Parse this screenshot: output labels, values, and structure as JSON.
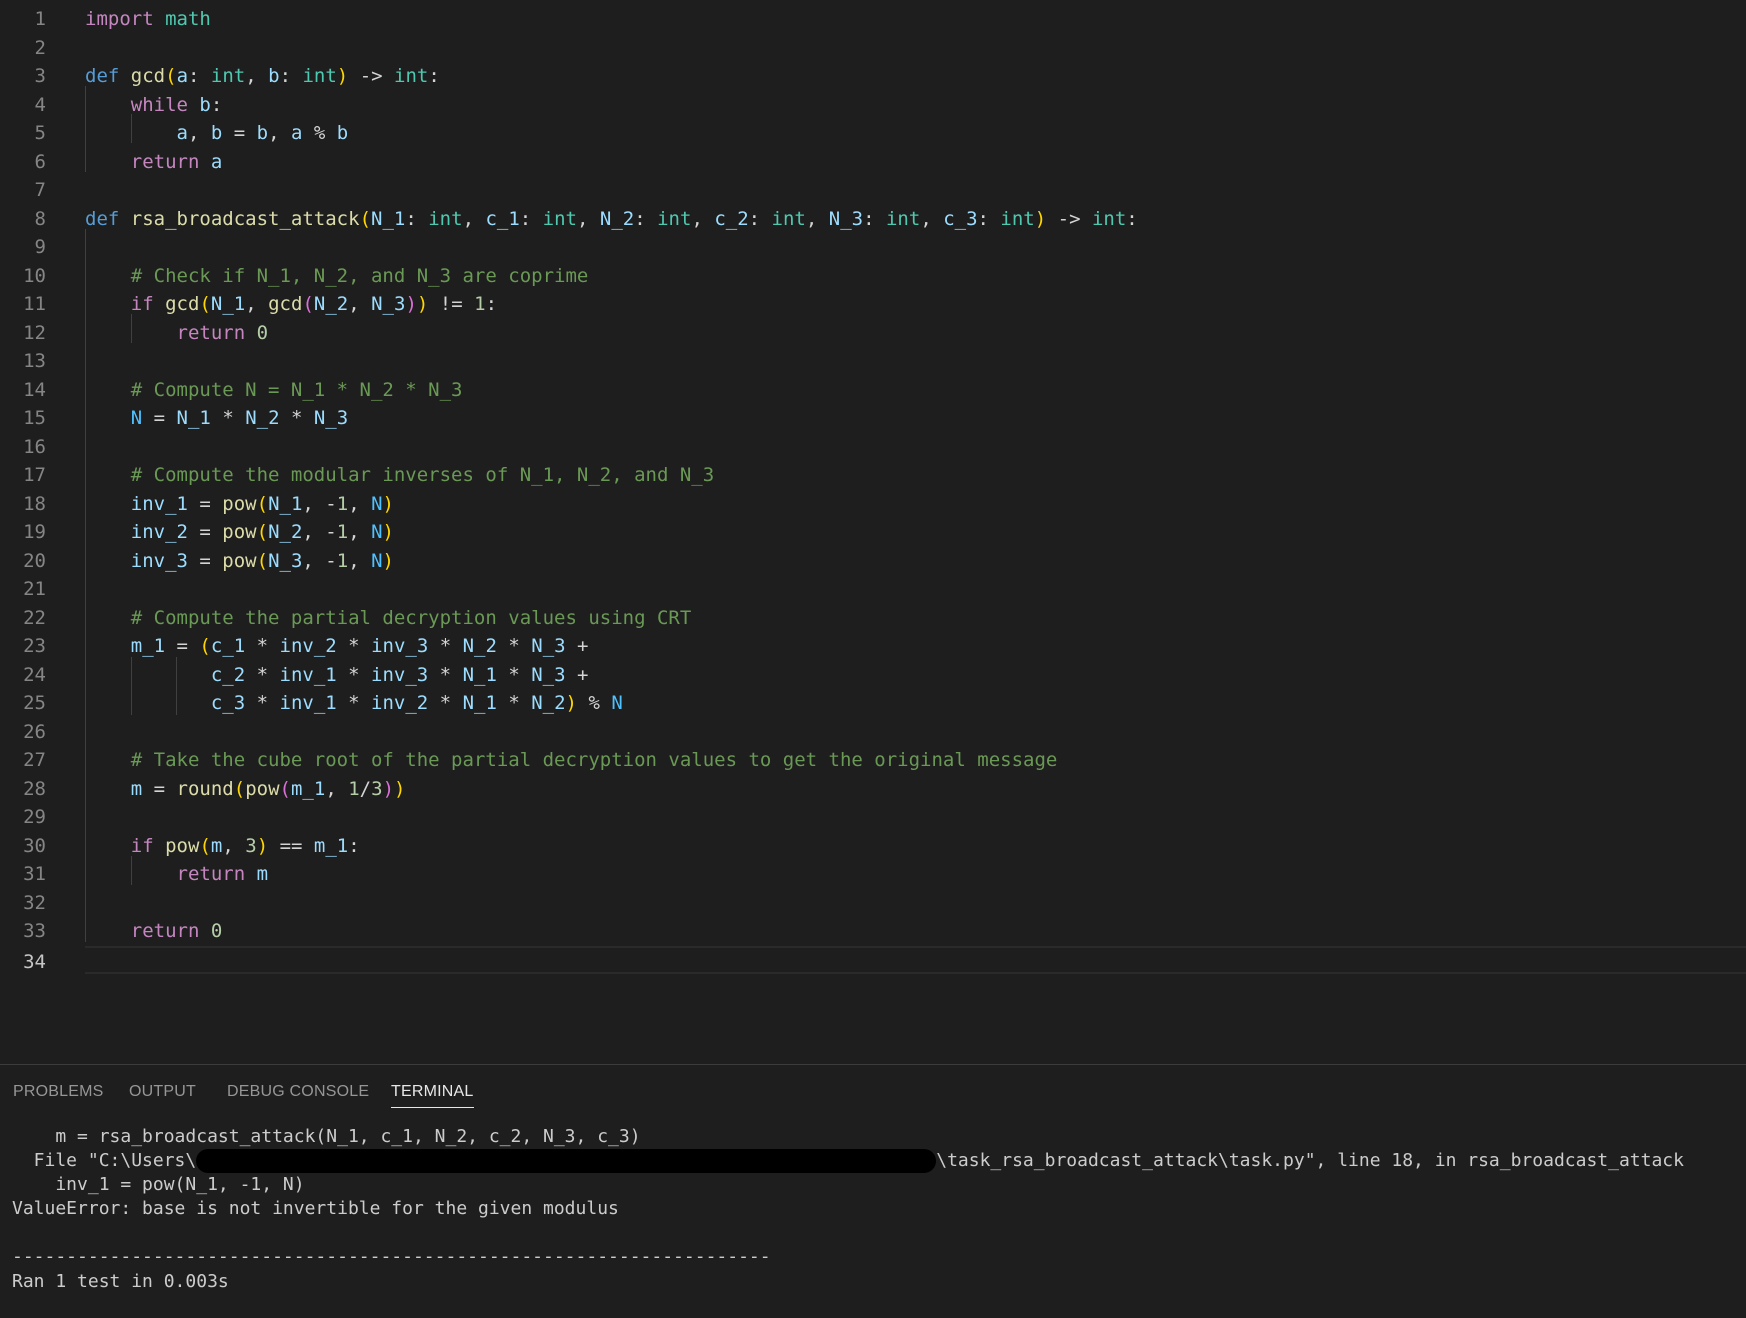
{
  "editor": {
    "line_numbers": [
      "1",
      "2",
      "3",
      "4",
      "5",
      "6",
      "7",
      "8",
      "9",
      "10",
      "11",
      "12",
      "13",
      "14",
      "15",
      "16",
      "17",
      "18",
      "19",
      "20",
      "21",
      "22",
      "23",
      "24",
      "25",
      "26",
      "27",
      "28",
      "29",
      "30",
      "31",
      "32",
      "33",
      "34"
    ],
    "lines": [
      [
        [
          "kw",
          "import"
        ],
        [
          "op",
          " "
        ],
        [
          "ty",
          "math"
        ]
      ],
      [],
      [
        [
          "df",
          "def"
        ],
        [
          "op",
          " "
        ],
        [
          "fn",
          "gcd"
        ],
        [
          "b1",
          "("
        ],
        [
          "pm",
          "a"
        ],
        [
          "op",
          ": "
        ],
        [
          "ty",
          "int"
        ],
        [
          "op",
          ", "
        ],
        [
          "pm",
          "b"
        ],
        [
          "op",
          ": "
        ],
        [
          "ty",
          "int"
        ],
        [
          "b1",
          ")"
        ],
        [
          "op",
          " -> "
        ],
        [
          "ty",
          "int"
        ],
        [
          "op",
          ":"
        ]
      ],
      [
        [
          "op",
          "    "
        ],
        [
          "kw",
          "while"
        ],
        [
          "op",
          " "
        ],
        [
          "pm",
          "b"
        ],
        [
          "op",
          ":"
        ]
      ],
      [
        [
          "op",
          "        "
        ],
        [
          "pm",
          "a"
        ],
        [
          "op",
          ", "
        ],
        [
          "pm",
          "b"
        ],
        [
          "op",
          " = "
        ],
        [
          "pm",
          "b"
        ],
        [
          "op",
          ", "
        ],
        [
          "pm",
          "a"
        ],
        [
          "op",
          " % "
        ],
        [
          "pm",
          "b"
        ]
      ],
      [
        [
          "op",
          "    "
        ],
        [
          "kw",
          "return"
        ],
        [
          "op",
          " "
        ],
        [
          "pm",
          "a"
        ]
      ],
      [],
      [
        [
          "df",
          "def"
        ],
        [
          "op",
          " "
        ],
        [
          "fn",
          "rsa_broadcast_attack"
        ],
        [
          "b1",
          "("
        ],
        [
          "pm",
          "N_1"
        ],
        [
          "op",
          ": "
        ],
        [
          "ty",
          "int"
        ],
        [
          "op",
          ", "
        ],
        [
          "pm",
          "c_1"
        ],
        [
          "op",
          ": "
        ],
        [
          "ty",
          "int"
        ],
        [
          "op",
          ", "
        ],
        [
          "pm",
          "N_2"
        ],
        [
          "op",
          ": "
        ],
        [
          "ty",
          "int"
        ],
        [
          "op",
          ", "
        ],
        [
          "pm",
          "c_2"
        ],
        [
          "op",
          ": "
        ],
        [
          "ty",
          "int"
        ],
        [
          "op",
          ", "
        ],
        [
          "pm",
          "N_3"
        ],
        [
          "op",
          ": "
        ],
        [
          "ty",
          "int"
        ],
        [
          "op",
          ", "
        ],
        [
          "pm",
          "c_3"
        ],
        [
          "op",
          ": "
        ],
        [
          "ty",
          "int"
        ],
        [
          "b1",
          ")"
        ],
        [
          "op",
          " -> "
        ],
        [
          "ty",
          "int"
        ],
        [
          "op",
          ":"
        ]
      ],
      [],
      [
        [
          "op",
          "    "
        ],
        [
          "cm",
          "# Check if N_1, N_2, and N_3 are coprime"
        ]
      ],
      [
        [
          "op",
          "    "
        ],
        [
          "kw",
          "if"
        ],
        [
          "op",
          " "
        ],
        [
          "fn",
          "gcd"
        ],
        [
          "b1",
          "("
        ],
        [
          "pm",
          "N_1"
        ],
        [
          "op",
          ", "
        ],
        [
          "fn",
          "gcd"
        ],
        [
          "b2",
          "("
        ],
        [
          "pm",
          "N_2"
        ],
        [
          "op",
          ", "
        ],
        [
          "pm",
          "N_3"
        ],
        [
          "b2",
          ")"
        ],
        [
          "b1",
          ")"
        ],
        [
          "op",
          " != "
        ],
        [
          "nm",
          "1"
        ],
        [
          "op",
          ":"
        ]
      ],
      [
        [
          "op",
          "        "
        ],
        [
          "kw",
          "return"
        ],
        [
          "op",
          " "
        ],
        [
          "nm",
          "0"
        ]
      ],
      [],
      [
        [
          "op",
          "    "
        ],
        [
          "cm",
          "# Compute N = N_1 * N_2 * N_3"
        ]
      ],
      [
        [
          "op",
          "    "
        ],
        [
          "cn",
          "N"
        ],
        [
          "op",
          " = "
        ],
        [
          "pm",
          "N_1"
        ],
        [
          "op",
          " * "
        ],
        [
          "pm",
          "N_2"
        ],
        [
          "op",
          " * "
        ],
        [
          "pm",
          "N_3"
        ]
      ],
      [],
      [
        [
          "op",
          "    "
        ],
        [
          "cm",
          "# Compute the modular inverses of N_1, N_2, and N_3"
        ]
      ],
      [
        [
          "op",
          "    "
        ],
        [
          "pm",
          "inv_1"
        ],
        [
          "op",
          " = "
        ],
        [
          "fn",
          "pow"
        ],
        [
          "b1",
          "("
        ],
        [
          "pm",
          "N_1"
        ],
        [
          "op",
          ", -"
        ],
        [
          "nm",
          "1"
        ],
        [
          "op",
          ", "
        ],
        [
          "cn",
          "N"
        ],
        [
          "b1",
          ")"
        ]
      ],
      [
        [
          "op",
          "    "
        ],
        [
          "pm",
          "inv_2"
        ],
        [
          "op",
          " = "
        ],
        [
          "fn",
          "pow"
        ],
        [
          "b1",
          "("
        ],
        [
          "pm",
          "N_2"
        ],
        [
          "op",
          ", -"
        ],
        [
          "nm",
          "1"
        ],
        [
          "op",
          ", "
        ],
        [
          "cn",
          "N"
        ],
        [
          "b1",
          ")"
        ]
      ],
      [
        [
          "op",
          "    "
        ],
        [
          "pm",
          "inv_3"
        ],
        [
          "op",
          " = "
        ],
        [
          "fn",
          "pow"
        ],
        [
          "b1",
          "("
        ],
        [
          "pm",
          "N_3"
        ],
        [
          "op",
          ", -"
        ],
        [
          "nm",
          "1"
        ],
        [
          "op",
          ", "
        ],
        [
          "cn",
          "N"
        ],
        [
          "b1",
          ")"
        ]
      ],
      [],
      [
        [
          "op",
          "    "
        ],
        [
          "cm",
          "# Compute the partial decryption values using CRT"
        ]
      ],
      [
        [
          "op",
          "    "
        ],
        [
          "pm",
          "m_1"
        ],
        [
          "op",
          " = "
        ],
        [
          "b1",
          "("
        ],
        [
          "pm",
          "c_1"
        ],
        [
          "op",
          " * "
        ],
        [
          "pm",
          "inv_2"
        ],
        [
          "op",
          " * "
        ],
        [
          "pm",
          "inv_3"
        ],
        [
          "op",
          " * "
        ],
        [
          "pm",
          "N_2"
        ],
        [
          "op",
          " * "
        ],
        [
          "pm",
          "N_3"
        ],
        [
          "op",
          " +"
        ]
      ],
      [
        [
          "op",
          "           "
        ],
        [
          "pm",
          "c_2"
        ],
        [
          "op",
          " * "
        ],
        [
          "pm",
          "inv_1"
        ],
        [
          "op",
          " * "
        ],
        [
          "pm",
          "inv_3"
        ],
        [
          "op",
          " * "
        ],
        [
          "pm",
          "N_1"
        ],
        [
          "op",
          " * "
        ],
        [
          "pm",
          "N_3"
        ],
        [
          "op",
          " +"
        ]
      ],
      [
        [
          "op",
          "           "
        ],
        [
          "pm",
          "c_3"
        ],
        [
          "op",
          " * "
        ],
        [
          "pm",
          "inv_1"
        ],
        [
          "op",
          " * "
        ],
        [
          "pm",
          "inv_2"
        ],
        [
          "op",
          " * "
        ],
        [
          "pm",
          "N_1"
        ],
        [
          "op",
          " * "
        ],
        [
          "pm",
          "N_2"
        ],
        [
          "b1",
          ")"
        ],
        [
          "op",
          " % "
        ],
        [
          "cn",
          "N"
        ]
      ],
      [],
      [
        [
          "op",
          "    "
        ],
        [
          "cm",
          "# Take the cube root of the partial decryption values to get the original message"
        ]
      ],
      [
        [
          "op",
          "    "
        ],
        [
          "pm",
          "m"
        ],
        [
          "op",
          " = "
        ],
        [
          "fn",
          "round"
        ],
        [
          "b1",
          "("
        ],
        [
          "fn",
          "pow"
        ],
        [
          "b2",
          "("
        ],
        [
          "pm",
          "m_1"
        ],
        [
          "op",
          ", "
        ],
        [
          "nm",
          "1"
        ],
        [
          "op",
          "/"
        ],
        [
          "nm",
          "3"
        ],
        [
          "b2",
          ")"
        ],
        [
          "b1",
          ")"
        ]
      ],
      [],
      [
        [
          "op",
          "    "
        ],
        [
          "kw",
          "if"
        ],
        [
          "op",
          " "
        ],
        [
          "fn",
          "pow"
        ],
        [
          "b1",
          "("
        ],
        [
          "pm",
          "m"
        ],
        [
          "op",
          ", "
        ],
        [
          "nm",
          "3"
        ],
        [
          "b1",
          ")"
        ],
        [
          "op",
          " == "
        ],
        [
          "pm",
          "m_1"
        ],
        [
          "op",
          ":"
        ]
      ],
      [
        [
          "op",
          "        "
        ],
        [
          "kw",
          "return"
        ],
        [
          "op",
          " "
        ],
        [
          "pm",
          "m"
        ]
      ],
      [],
      [
        [
          "op",
          "    "
        ],
        [
          "kw",
          "return"
        ],
        [
          "op",
          " "
        ],
        [
          "nm",
          "0"
        ]
      ],
      []
    ]
  },
  "panel": {
    "tabs": [
      {
        "label": "PROBLEMS",
        "active": false
      },
      {
        "label": "OUTPUT",
        "active": false
      },
      {
        "label": "DEBUG CONSOLE",
        "active": false
      },
      {
        "label": "TERMINAL",
        "active": true
      }
    ],
    "terminal": {
      "line1": "    m = rsa_broadcast_attack(N_1, c_1, N_2, c_2, N_3, c_3)",
      "line2_prefix": "  File \"C:\\Users\\",
      "line2_suffix": "\\task_rsa_broadcast_attack\\task.py\", line 18, in rsa_broadcast_attack",
      "line3": "    inv_1 = pow(N_1, -1, N)",
      "line4": "ValueError: base is not invertible for the given modulus",
      "line5": "----------------------------------------------------------------------",
      "line6": "Ran 1 test in 0.003s"
    }
  }
}
